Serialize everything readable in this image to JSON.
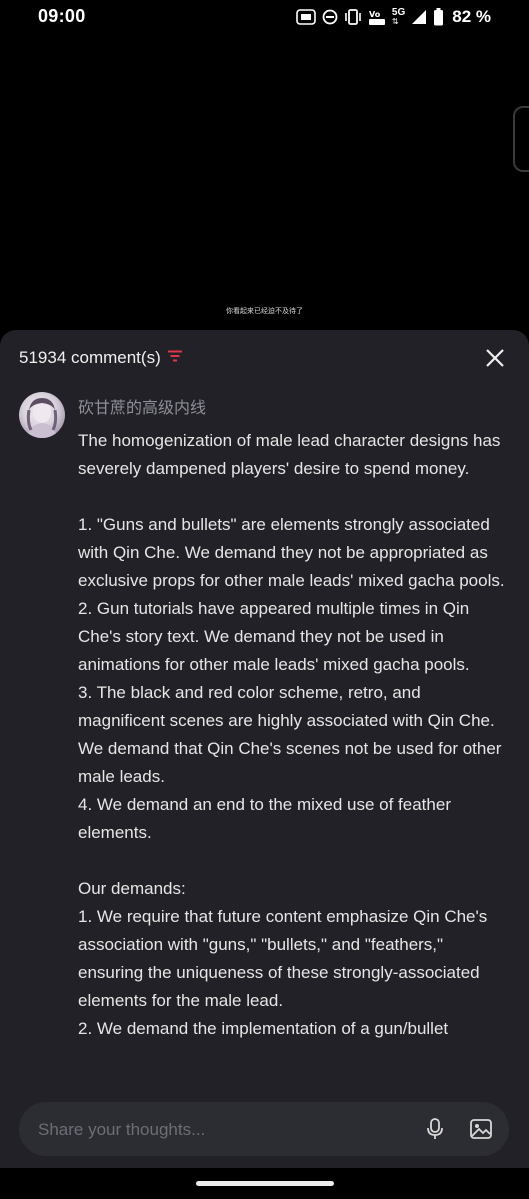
{
  "status_bar": {
    "time": "09:00",
    "network": "5G",
    "battery": "82 %",
    "icons": [
      "nfc-icon",
      "dnd-icon",
      "vibrate-icon",
      "volte-icon",
      "signal-icon",
      "battery-icon"
    ]
  },
  "video": {
    "subtitle": "你看起来已经迫不及待了"
  },
  "comments_panel": {
    "count_label": "51934 comment(s)",
    "accent_color": "#e0344a",
    "comment": {
      "username": "砍甘蔗的高级内线",
      "text": "The homogenization of male lead character designs has severely dampened players' desire to spend money.\n\n1. \"Guns and bullets\" are elements strongly associated with Qin Che. We demand they not be appropriated as exclusive props for other male leads' mixed gacha pools.\n2. Gun tutorials have appeared multiple times in Qin Che's story text. We demand they not be used in animations for other male leads' mixed gacha pools.\n3. The black and red color scheme, retro, and magnificent scenes are highly associated with Qin Che. We demand that Qin Che's scenes not be used for other male leads.\n4. We demand an end to the mixed use of feather elements.\n\nOur demands:\n1. We require that future content emphasize Qin Che's association with \"guns,\" \"bullets,\" and \"feathers,\" ensuring the uniqueness of these strongly-associated elements for the male lead.\n2. We demand the implementation of a gun/bullet"
    }
  },
  "input": {
    "placeholder": "Share your thoughts..."
  }
}
